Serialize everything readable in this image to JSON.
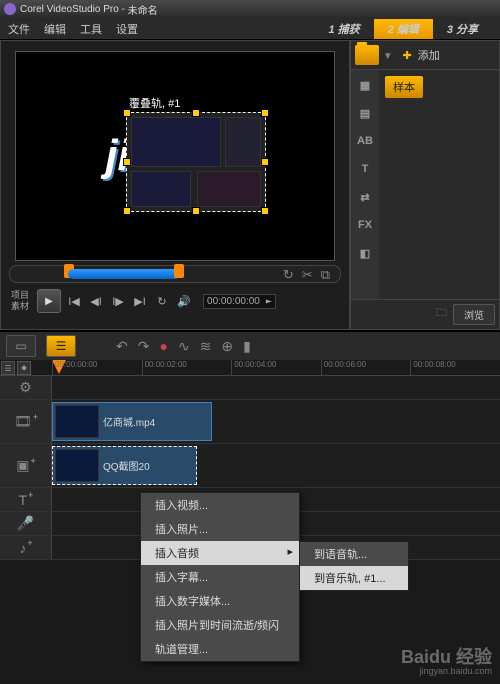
{
  "titlebar": {
    "app": "Corel VideoStudio Pro",
    "doc": "未命名"
  },
  "menu": {
    "file": "文件",
    "edit": "编辑",
    "tools": "工具",
    "settings": "设置"
  },
  "steps": {
    "s1_num": "1",
    "s1": "捕获",
    "s2_num": "2",
    "s2": "编辑",
    "s3_num": "3",
    "s3": "分享"
  },
  "preview": {
    "overlay_label": "覆叠轨, #1",
    "bg_text": "jis            ng ."
  },
  "controls": {
    "proj": "项目",
    "clip": "素材",
    "timecode": "00:00:00:00"
  },
  "library": {
    "add": "添加",
    "sample": "样本",
    "browse": "浏览"
  },
  "sidetabs": {
    "media": "▦",
    "color": "▤",
    "text_ab": "AB",
    "title": "T",
    "trans": "⇄",
    "fx": "FX",
    "filter": "◧"
  },
  "timeline_tools": {
    "undo": "↶",
    "redo": "↷",
    "rec": "●",
    "snd": "∿",
    "mix": "≋",
    "zoom": "⊕",
    "marker": "▮"
  },
  "ruler": {
    "t0": "00:00:00:00",
    "t1": "00:00:02:00",
    "t2": "00:00:04:00",
    "t3": "00:00:06:00",
    "t4": "00:00:08:00"
  },
  "clips": {
    "c1": "亿商城.mp4",
    "c2": "QQ截图20"
  },
  "ctx": {
    "insert_video": "插入视频...",
    "insert_photo": "插入照片...",
    "insert_audio": "插入音频",
    "insert_subtitle": "插入字幕...",
    "insert_digital": "插入数字媒体...",
    "insert_timelapse": "插入照片到时间流逝/频闪",
    "track_mgr": "轨道管理..."
  },
  "submenu": {
    "to_voice": "到语音轨...",
    "to_music": "到音乐轨, #1..."
  },
  "watermark": {
    "brand": "Baidu 经验",
    "url": "jingyan.baidu.com"
  }
}
